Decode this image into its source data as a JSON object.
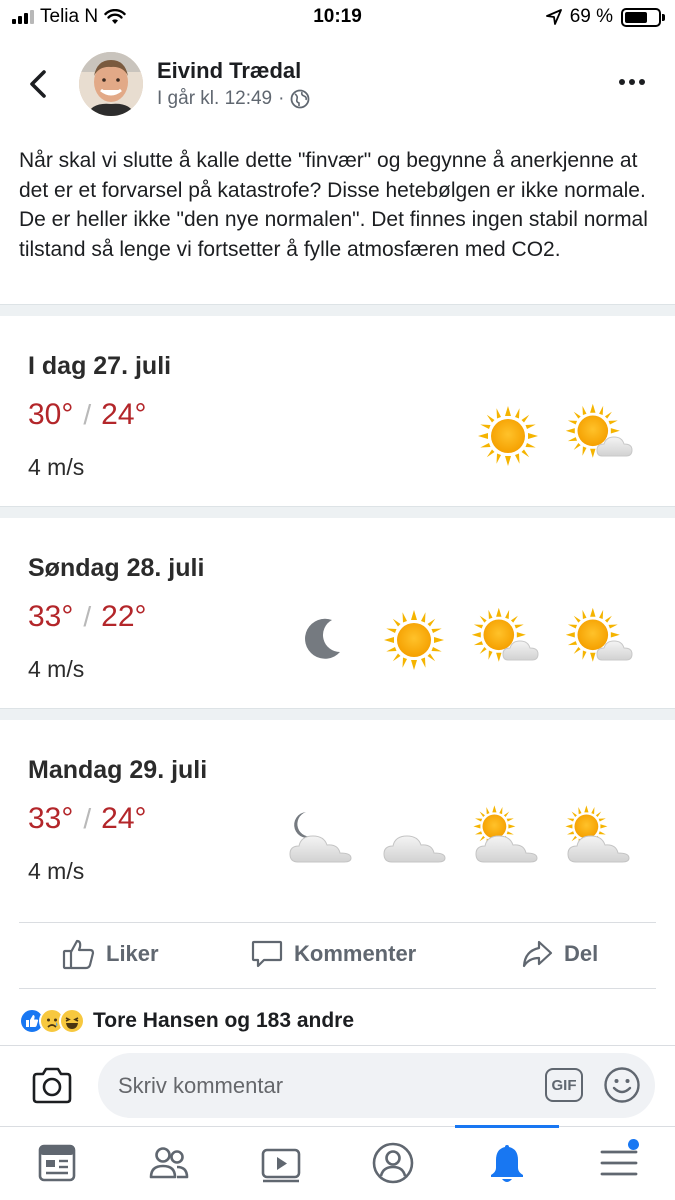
{
  "status_bar": {
    "carrier": "Telia N",
    "time": "10:19",
    "battery_percent": "69 %",
    "battery_level": 0.69
  },
  "post": {
    "author": "Eivind Trædal",
    "timestamp": "I går kl. 12:49",
    "meta_separator": "·",
    "text": "Når skal vi slutte å kalle dette \"finvær\" og begynne å anerkjenne at det er et forvarsel på katastrofe? Disse hetebølgen er ikke normale. De er heller ikke \"den nye normalen\". Det finnes ingen stabil normal tilstand så lenge vi fortsetter å fylle atmosfæren med CO2."
  },
  "forecast": [
    {
      "day": "I dag 27. juli",
      "high": "30°",
      "low": "24°",
      "wind": "4 m/s",
      "icons": [
        "sun-icon",
        "sun-cloud-icon"
      ]
    },
    {
      "day": "Søndag 28. juli",
      "high": "33°",
      "low": "22°",
      "wind": "4 m/s",
      "icons": [
        "moon-icon",
        "sun-icon",
        "sun-cloud-icon",
        "sun-cloud-icon"
      ]
    },
    {
      "day": "Mandag 29. juli",
      "high": "33°",
      "low": "24°",
      "wind": "4 m/s",
      "icons": [
        "moon-cloud-icon",
        "cloud-icon",
        "sun-cloud-large-icon",
        "sun-cloud-large-icon"
      ]
    }
  ],
  "forecast_slash": "/",
  "actions": {
    "like": "Liker",
    "comment": "Kommenter",
    "share": "Del"
  },
  "reactions": {
    "types": [
      "like-reaction-icon",
      "sad-reaction-icon",
      "haha-reaction-icon"
    ],
    "summary": "Tore Hansen og 183 andre"
  },
  "composer": {
    "placeholder": "Skriv kommentar",
    "gif_label": "GIF"
  },
  "tabbar": {
    "tabs": [
      "news-feed-icon",
      "friends-icon",
      "watch-icon",
      "profile-icon",
      "notifications-icon",
      "menu-icon"
    ],
    "active": "notifications-icon"
  },
  "colors": {
    "temperature": "#b3262a",
    "accent": "#1877f2",
    "muted": "#606770"
  }
}
